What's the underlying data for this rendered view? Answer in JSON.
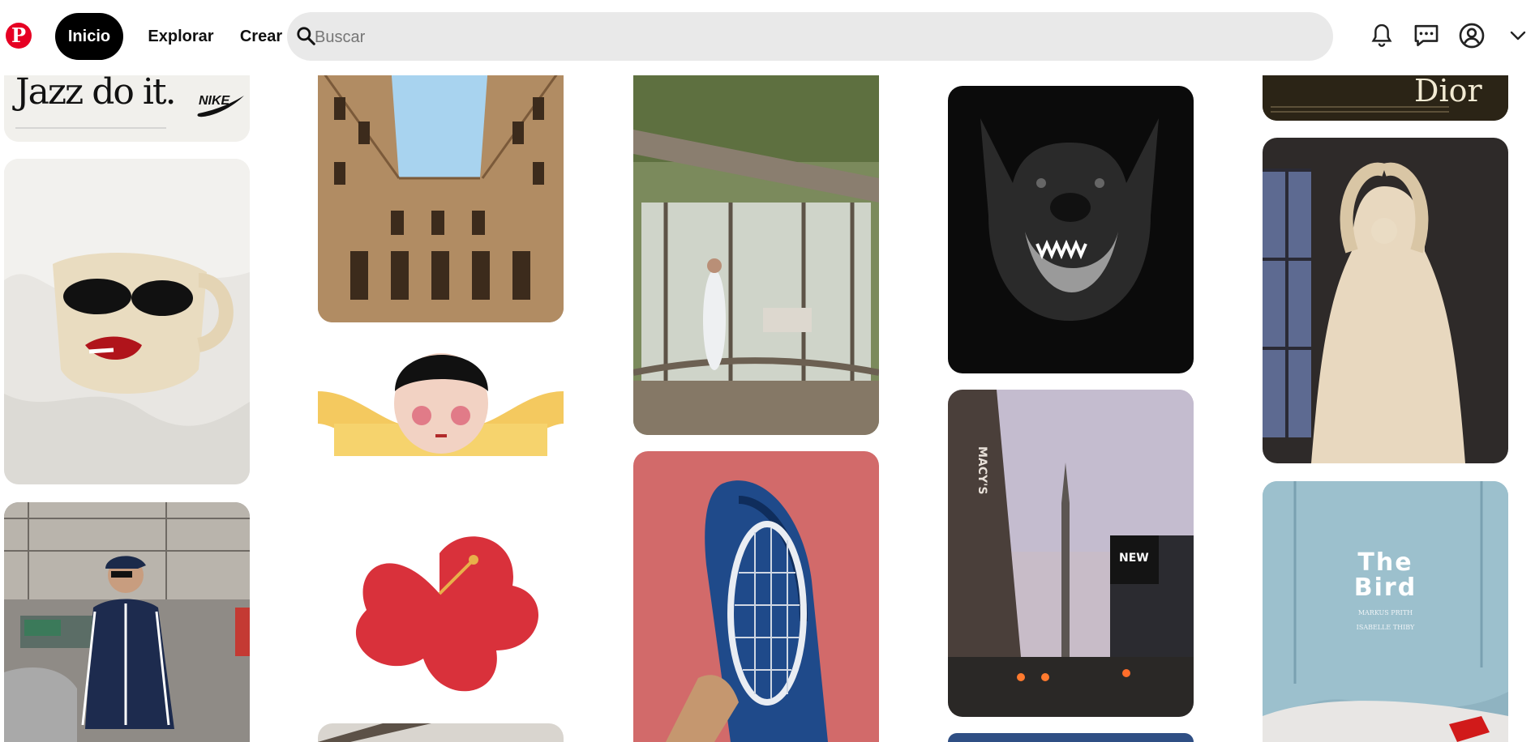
{
  "header": {
    "logo_icon": "pinterest-logo-icon",
    "nav": [
      {
        "label": "Inicio",
        "active": true
      },
      {
        "label": "Explorar",
        "active": false
      },
      {
        "label": "Crear",
        "active": false
      }
    ],
    "search": {
      "placeholder": "Buscar",
      "value": "",
      "icon": "search-icon"
    },
    "icons": [
      "bell-icon",
      "chat-icon",
      "account-icon",
      "chevron-down-icon"
    ]
  },
  "pins": [
    {
      "id": "nike-jazz",
      "text": "Jazz do it.",
      "brand": "NIKE"
    },
    {
      "id": "ceramic-mug"
    },
    {
      "id": "adidas-street"
    },
    {
      "id": "courtyard-sky"
    },
    {
      "id": "illustrated-girl"
    },
    {
      "id": "hibiscus-flower"
    },
    {
      "id": "architecture-bottom"
    },
    {
      "id": "glass-house-woman"
    },
    {
      "id": "tennis-bag"
    },
    {
      "id": "doberman"
    },
    {
      "id": "nyc-street",
      "sign": "MACY'S",
      "billboard": "NEW"
    },
    {
      "id": "blue-card-bottom"
    },
    {
      "id": "dior-ad",
      "text": "Dior"
    },
    {
      "id": "marble-statue"
    },
    {
      "id": "the-bird-denim",
      "title": "The\nBird",
      "credit1": "MARKUS PRITH",
      "credit2": "ISABELLE THIBY"
    }
  ],
  "colors": {
    "brand": "#e60023",
    "search_bg": "#e9e9e9",
    "active_nav": "#000000"
  }
}
